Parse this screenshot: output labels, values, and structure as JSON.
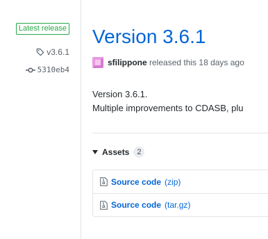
{
  "sidebar": {
    "release_label": "Latest release",
    "tag": "v3.6.1",
    "commit": "5310eb4"
  },
  "release": {
    "title": "Version 3.6.1",
    "author": "sfilippone",
    "released_text": "released this 18 days ago",
    "body": [
      "Version 3.6.1.",
      "Multiple improvements to CDASB, plu"
    ]
  },
  "assets": {
    "label": "Assets",
    "count": "2",
    "items": [
      {
        "name": "Source code",
        "ext": "(zip)"
      },
      {
        "name": "Source code",
        "ext": "(tar.gz)"
      }
    ]
  },
  "colors": {
    "link": "#0366d6",
    "latest_green": "#28a745",
    "muted": "#586069",
    "border": "#e1e4e8"
  }
}
